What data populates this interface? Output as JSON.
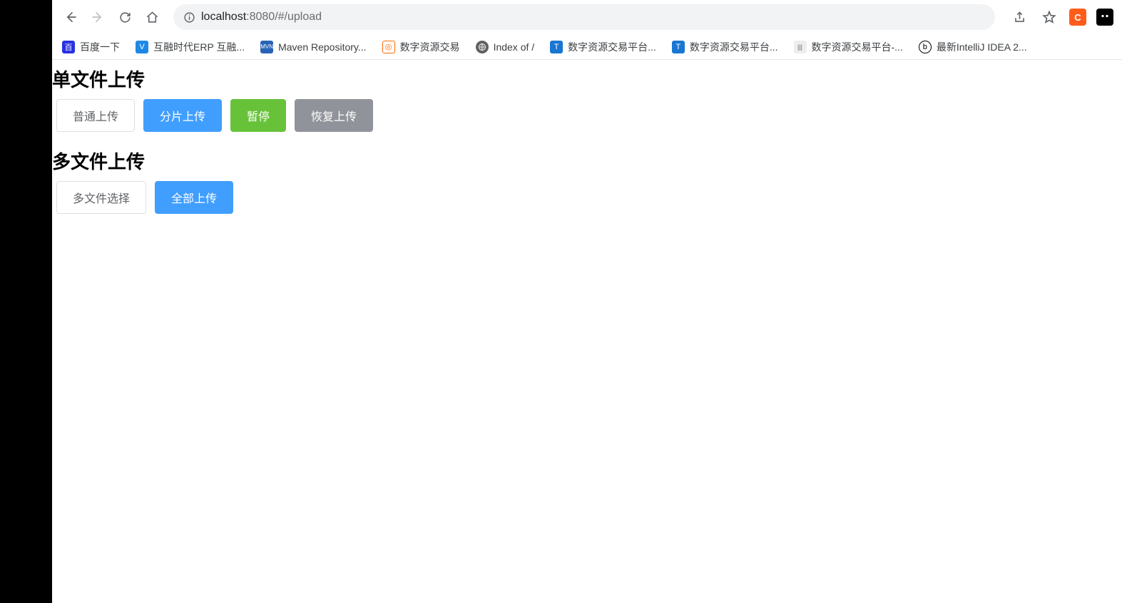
{
  "browser": {
    "url_host": "localhost",
    "url_port_path": ":8080/#/upload"
  },
  "bookmarks": [
    {
      "label": "百度一下",
      "icon_color": "#2932e1",
      "icon_glyph": "百"
    },
    {
      "label": "互融时代ERP 互融...",
      "icon_color": "#1e88e5",
      "icon_glyph": "V"
    },
    {
      "label": "Maven Repository...",
      "icon_color": "#2863b7",
      "icon_glyph": "M"
    },
    {
      "label": "数字资源交易",
      "icon_color": "#ff6a00",
      "icon_glyph": "◎"
    },
    {
      "label": "Index of /",
      "icon_color": "#616161",
      "icon_glyph": "●"
    },
    {
      "label": "数字资源交易平台...",
      "icon_color": "#1976d2",
      "icon_glyph": "T"
    },
    {
      "label": "数字资源交易平台...",
      "icon_color": "#1976d2",
      "icon_glyph": "T"
    },
    {
      "label": "数字资源交易平台-...",
      "icon_color": "#666666",
      "icon_glyph": "|||"
    },
    {
      "label": "最新IntelliJ IDEA 2...",
      "icon_color": "#000000",
      "icon_glyph": "b"
    }
  ],
  "sections": {
    "single": {
      "title": "单文件上传",
      "buttons": [
        {
          "label": "普通上传",
          "style": "default"
        },
        {
          "label": "分片上传",
          "style": "primary"
        },
        {
          "label": "暂停",
          "style": "success"
        },
        {
          "label": "恢复上传",
          "style": "info"
        }
      ]
    },
    "multi": {
      "title": "多文件上传",
      "buttons": [
        {
          "label": "多文件选择",
          "style": "default"
        },
        {
          "label": "全部上传",
          "style": "primary"
        }
      ]
    }
  },
  "extensions": {
    "c_label": "C"
  }
}
